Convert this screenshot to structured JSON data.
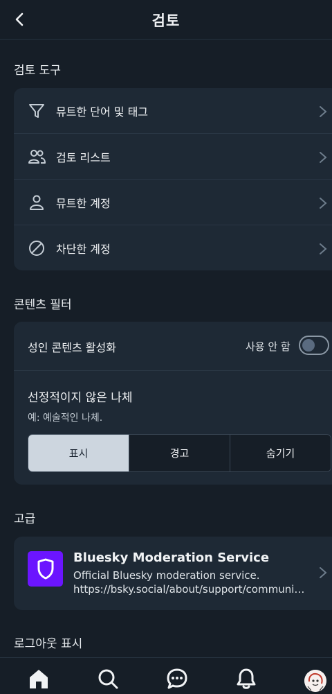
{
  "header": {
    "title": "검토"
  },
  "sections": {
    "tools_title": "검토 도구",
    "filters_title": "콘텐츠 필터",
    "advanced_title": "고급",
    "logout_title": "로그아웃 표시"
  },
  "tools": [
    {
      "label": "뮤트한 단어 및 태그",
      "icon": "filter-icon"
    },
    {
      "label": "검토 리스트",
      "icon": "users-icon"
    },
    {
      "label": "뮤트한 계정",
      "icon": "person-icon"
    },
    {
      "label": "차단한 계정",
      "icon": "block-icon"
    }
  ],
  "filters": {
    "adult_label": "성인 콘텐츠 활성화",
    "adult_status": "사용 안 함",
    "adult_enabled": false,
    "nudity_title": "선정적이지 않은 나체",
    "nudity_desc": "예: 예술적인 나체.",
    "options": [
      "표시",
      "경고",
      "숨기기"
    ],
    "selected": "표시"
  },
  "labeler": {
    "name": "Bluesky Moderation Service",
    "desc": "Official Bluesky moderation service.",
    "url": "https://bsky.social/about/support/community-guidelines"
  },
  "tabbar": {
    "items": [
      "home-icon",
      "search-icon",
      "chat-icon",
      "bell-icon",
      "avatar"
    ]
  },
  "colors": {
    "background": "#161e27",
    "card": "#1e2935",
    "brand": "#6b15ff",
    "selected_option": "#cdd6df"
  }
}
